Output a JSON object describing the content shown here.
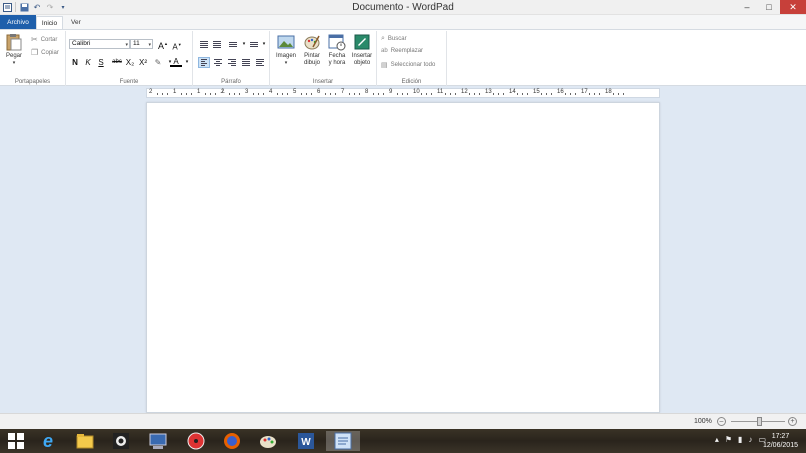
{
  "window": {
    "title": "Documento - WordPad",
    "controls": {
      "minimize": "–",
      "maximize": "□",
      "close": "✕"
    }
  },
  "quick_access": [
    "save-icon",
    "undo-icon",
    "redo-icon",
    "customize-icon"
  ],
  "tabs": [
    {
      "label": "Archivo",
      "active": false
    },
    {
      "label": "Inicio",
      "active": true
    },
    {
      "label": "Ver",
      "active": false
    }
  ],
  "ribbon": {
    "clipboard": {
      "label": "Portapapeles",
      "paste": "Pegar",
      "cut": "Cortar",
      "copy": "Copiar"
    },
    "font": {
      "label": "Fuente",
      "family": "Calibri",
      "size": "11",
      "bold": "N",
      "italic": "K",
      "underline": "S",
      "strike": "abc",
      "subscript": "X₂",
      "superscript": "X²",
      "grow": "A",
      "shrink": "A"
    },
    "paragraph": {
      "label": "Párrafo"
    },
    "insert": {
      "label": "Insertar",
      "image": "Imagen",
      "paint_line1": "Pintar",
      "paint_line2": "dibujo",
      "datetime_line1": "Fecha",
      "datetime_line2": "y hora",
      "object_line1": "Insertar",
      "object_line2": "objeto"
    },
    "editing": {
      "label": "Edición",
      "find": "Buscar",
      "replace": "Reemplazar",
      "select_all": "Seleccionar todo"
    }
  },
  "ruler": {
    "labels": [
      "2",
      "1",
      "1",
      "2",
      "3",
      "4",
      "5",
      "6",
      "7",
      "8",
      "9",
      "10",
      "11",
      "12",
      "13",
      "14",
      "15",
      "16",
      "17",
      "18"
    ]
  },
  "status": {
    "zoom": "100%"
  },
  "taskbar": {
    "apps": [
      "windows-start-icon",
      "internet-explorer-icon",
      "file-explorer-icon",
      "camera-app-icon",
      "network-app-icon",
      "dvd-app-icon",
      "firefox-icon",
      "paint-app-icon",
      "word-icon",
      "wordpad-icon"
    ],
    "time": "17:27",
    "date": "12/06/2015"
  },
  "colors": {
    "file_tab": "#1e5fab",
    "close_button": "#c7403a",
    "canvas": "#dfe8f3"
  }
}
